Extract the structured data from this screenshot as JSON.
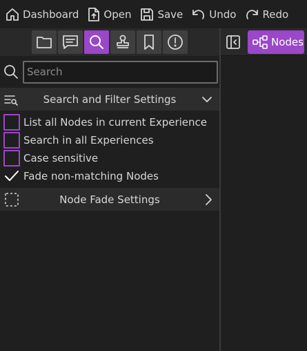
{
  "toolbar": {
    "dashboard_label": "Dashboard",
    "open_label": "Open",
    "save_label": "Save",
    "undo_label": "Undo",
    "redo_label": "Redo"
  },
  "sidebar_tabs": [
    {
      "icon": "folder-icon",
      "active": false
    },
    {
      "icon": "notes-icon",
      "active": false
    },
    {
      "icon": "search-icon",
      "active": true
    },
    {
      "icon": "stamp-icon",
      "active": false
    },
    {
      "icon": "bookmark-icon",
      "active": false
    },
    {
      "icon": "alert-icon",
      "active": false
    }
  ],
  "search": {
    "placeholder": "Search",
    "value": ""
  },
  "filter_section": {
    "title": "Search and Filter Settings",
    "expanded": true,
    "options": [
      {
        "label": "List all Nodes in current Experience",
        "checked": false
      },
      {
        "label": "Search in all Experiences",
        "checked": false
      },
      {
        "label": "Case sensitive",
        "checked": false
      },
      {
        "label": "Fade non-matching Nodes",
        "checked": true
      }
    ]
  },
  "fade_section": {
    "title": "Node Fade Settings",
    "expanded": false
  },
  "right_panel": {
    "nodes_tab_label": "Nodes"
  },
  "colors": {
    "accent": "#9a47c8",
    "background": "#1f1f1f",
    "panel_header": "#292929",
    "text": "#d6d6d6"
  }
}
